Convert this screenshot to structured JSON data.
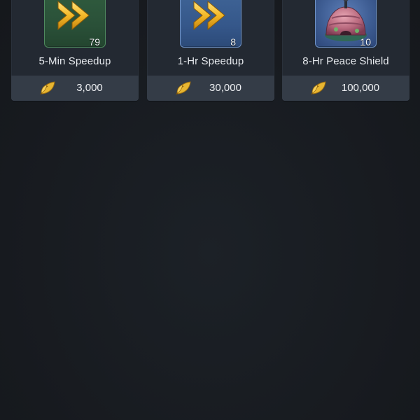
{
  "shop": {
    "items": [
      {
        "name": "5-Min Speedup",
        "quantity": "79",
        "price": "3,000",
        "icon": "double-chevron-speedup-icon",
        "tile_color": "#2f5b3e"
      },
      {
        "name": "1-Hr Speedup",
        "quantity": "8",
        "price": "30,000",
        "icon": "double-chevron-speedup-icon",
        "tile_color": "#3f6496"
      },
      {
        "name": "8-Hr Peace Shield",
        "quantity": "10",
        "price": "100,000",
        "icon": "dome-shield-icon",
        "tile_color": "#3f5e94"
      }
    ],
    "currency_icon": "golden-leaf-icon",
    "colors": {
      "background": "#181c21",
      "card": "#232932",
      "price_bar": "#343c47",
      "accent_gold": "#e8b631"
    }
  }
}
